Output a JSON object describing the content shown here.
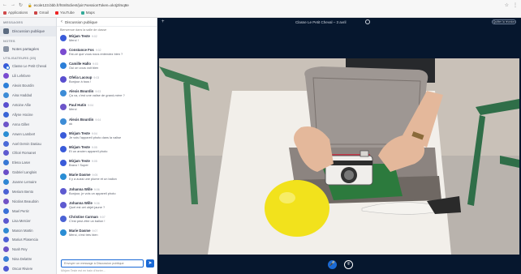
{
  "browser": {
    "nav": [
      "←",
      "→",
      "↻"
    ],
    "url": "ecole123.bbb.fr/html5client/join?sessionToken=xk4j2lmq8e",
    "bookmarks": [
      {
        "label": "Applications",
        "color": "#d04a4a"
      },
      {
        "label": "Gmail",
        "color": "#c44"
      },
      {
        "label": "YouTube",
        "color": "#e22"
      },
      {
        "label": "Maps",
        "color": "#3a9"
      }
    ],
    "right_icons": [
      "☆",
      "⋮"
    ]
  },
  "users_panel": {
    "messages_section": "MESSAGES",
    "public_chat": "Discussion publique",
    "notes_section": "NOTES",
    "shared_notes": "Notes partagées",
    "users_section": "UTILISATEURS (35)",
    "users": [
      {
        "name": "Classe Le Petit Cheval",
        "color": "#3a5bd9",
        "presenter": true
      },
      {
        "name": "Lili Lefebvre",
        "color": "#7a4bd0"
      },
      {
        "name": "Alexis Bourdin",
        "color": "#2c7fd8"
      },
      {
        "name": "Aina Haddad",
        "color": "#3d8cd6"
      },
      {
        "name": "Antoine Allie",
        "color": "#5a4fcf"
      },
      {
        "name": "Allyne Hocine",
        "color": "#3a65d6"
      },
      {
        "name": "Anna Gilles",
        "color": "#6d55c9"
      },
      {
        "name": "Arwen Lambert",
        "color": "#2a8dd4"
      },
      {
        "name": "Axel Dervin Daniau",
        "color": "#4a6ad8"
      },
      {
        "name": "Chloé Romanet",
        "color": "#5e5ad0"
      },
      {
        "name": "Elena Laser",
        "color": "#3778d5"
      },
      {
        "name": "Gabriel Langlois",
        "color": "#6a4ec8"
      },
      {
        "name": "Joanne Lemaire",
        "color": "#2f86d3"
      },
      {
        "name": "Meriam Bento",
        "color": "#4b62d4"
      },
      {
        "name": "Nicolas Beaudoin",
        "color": "#7153c6"
      },
      {
        "name": "Mael Perrin",
        "color": "#3a70d7"
      },
      {
        "name": "Lisa Mercier",
        "color": "#5c58cf"
      },
      {
        "name": "Manon Martin",
        "color": "#2f8ad2"
      },
      {
        "name": "Marius Plasencia",
        "color": "#4d5fd5"
      },
      {
        "name": "Noah Rey",
        "color": "#6a52c7"
      },
      {
        "name": "Nina Delattre",
        "color": "#377ed4"
      },
      {
        "name": "Oscar Riviere",
        "color": "#4f5ad2"
      }
    ]
  },
  "chat": {
    "title": "Discussion publique",
    "welcome": "Bienvenue dans la salle de classe",
    "messages": [
      {
        "author": "Mirjam Teste",
        "time": "9:02",
        "text": "Merci !",
        "color": "#3a5bd9"
      },
      {
        "author": "Constance Fos",
        "time": "9:02",
        "text": "Est-ce que vous nous entendez bien ?",
        "color": "#7a4bd0"
      },
      {
        "author": "Camille Hallo",
        "time": "9:03",
        "text": "Oui on vous voit bien",
        "color": "#2c7fd8"
      },
      {
        "author": "Ofelia Lacoup",
        "time": "9:03",
        "text": "Bonjour à tous !",
        "color": "#5a4fcf"
      },
      {
        "author": "Alexis Bourdin",
        "time": "9:03",
        "text": "Ça va, c'est une valise de grand-mère ?",
        "color": "#3d8cd6"
      },
      {
        "author": "Paul Hutin",
        "time": "9:04",
        "text": "Merci",
        "color": "#6d55c9"
      },
      {
        "author": "Alexis Bourdin",
        "time": "9:04",
        "text": "ok",
        "color": "#3d8cd6"
      },
      {
        "author": "Mirjam Teste",
        "time": "9:04",
        "text": "Je vois l'appareil photo dans la valise",
        "color": "#3a5bd9"
      },
      {
        "author": "Mirjam Teste",
        "time": "9:05",
        "text": "Et un ancien appareil photo",
        "color": "#3a5bd9"
      },
      {
        "author": "Mirjam Teste",
        "time": "9:05",
        "text": "Bravo ! Super",
        "color": "#3a5bd9"
      },
      {
        "author": "Marie Dasme",
        "time": "9:05",
        "text": "Il y a aussi une plume et un ballon",
        "color": "#2a8dd4"
      },
      {
        "author": "Johanna Wille",
        "time": "9:06",
        "text": "Bonjour, je vois un appareil photo",
        "color": "#5e5ad0"
      },
      {
        "author": "Johanna Wille",
        "time": "9:06",
        "text": "Quel est cet objet jaune ?",
        "color": "#5e5ad0"
      },
      {
        "author": "Christine Carman",
        "time": "9:07",
        "text": "C'est peut-être un ballon !",
        "color": "#4b62d4"
      },
      {
        "author": "Marie Dasme",
        "time": "9:07",
        "text": "Merci, c'est très bien",
        "color": "#2a8dd4"
      }
    ],
    "input_placeholder": "Envoyer un message à Discussion publique",
    "send_icon": "➤",
    "footer": "Mirjam Teste est en train d'écrire…"
  },
  "presentation": {
    "meeting_title": "Classe Le Petit Cheval – 3 avril",
    "right_button": "Quitter la réunion",
    "left_icon": "+",
    "controls": {
      "audio_icon": "🎤",
      "camera_icon": "⌾"
    }
  }
}
